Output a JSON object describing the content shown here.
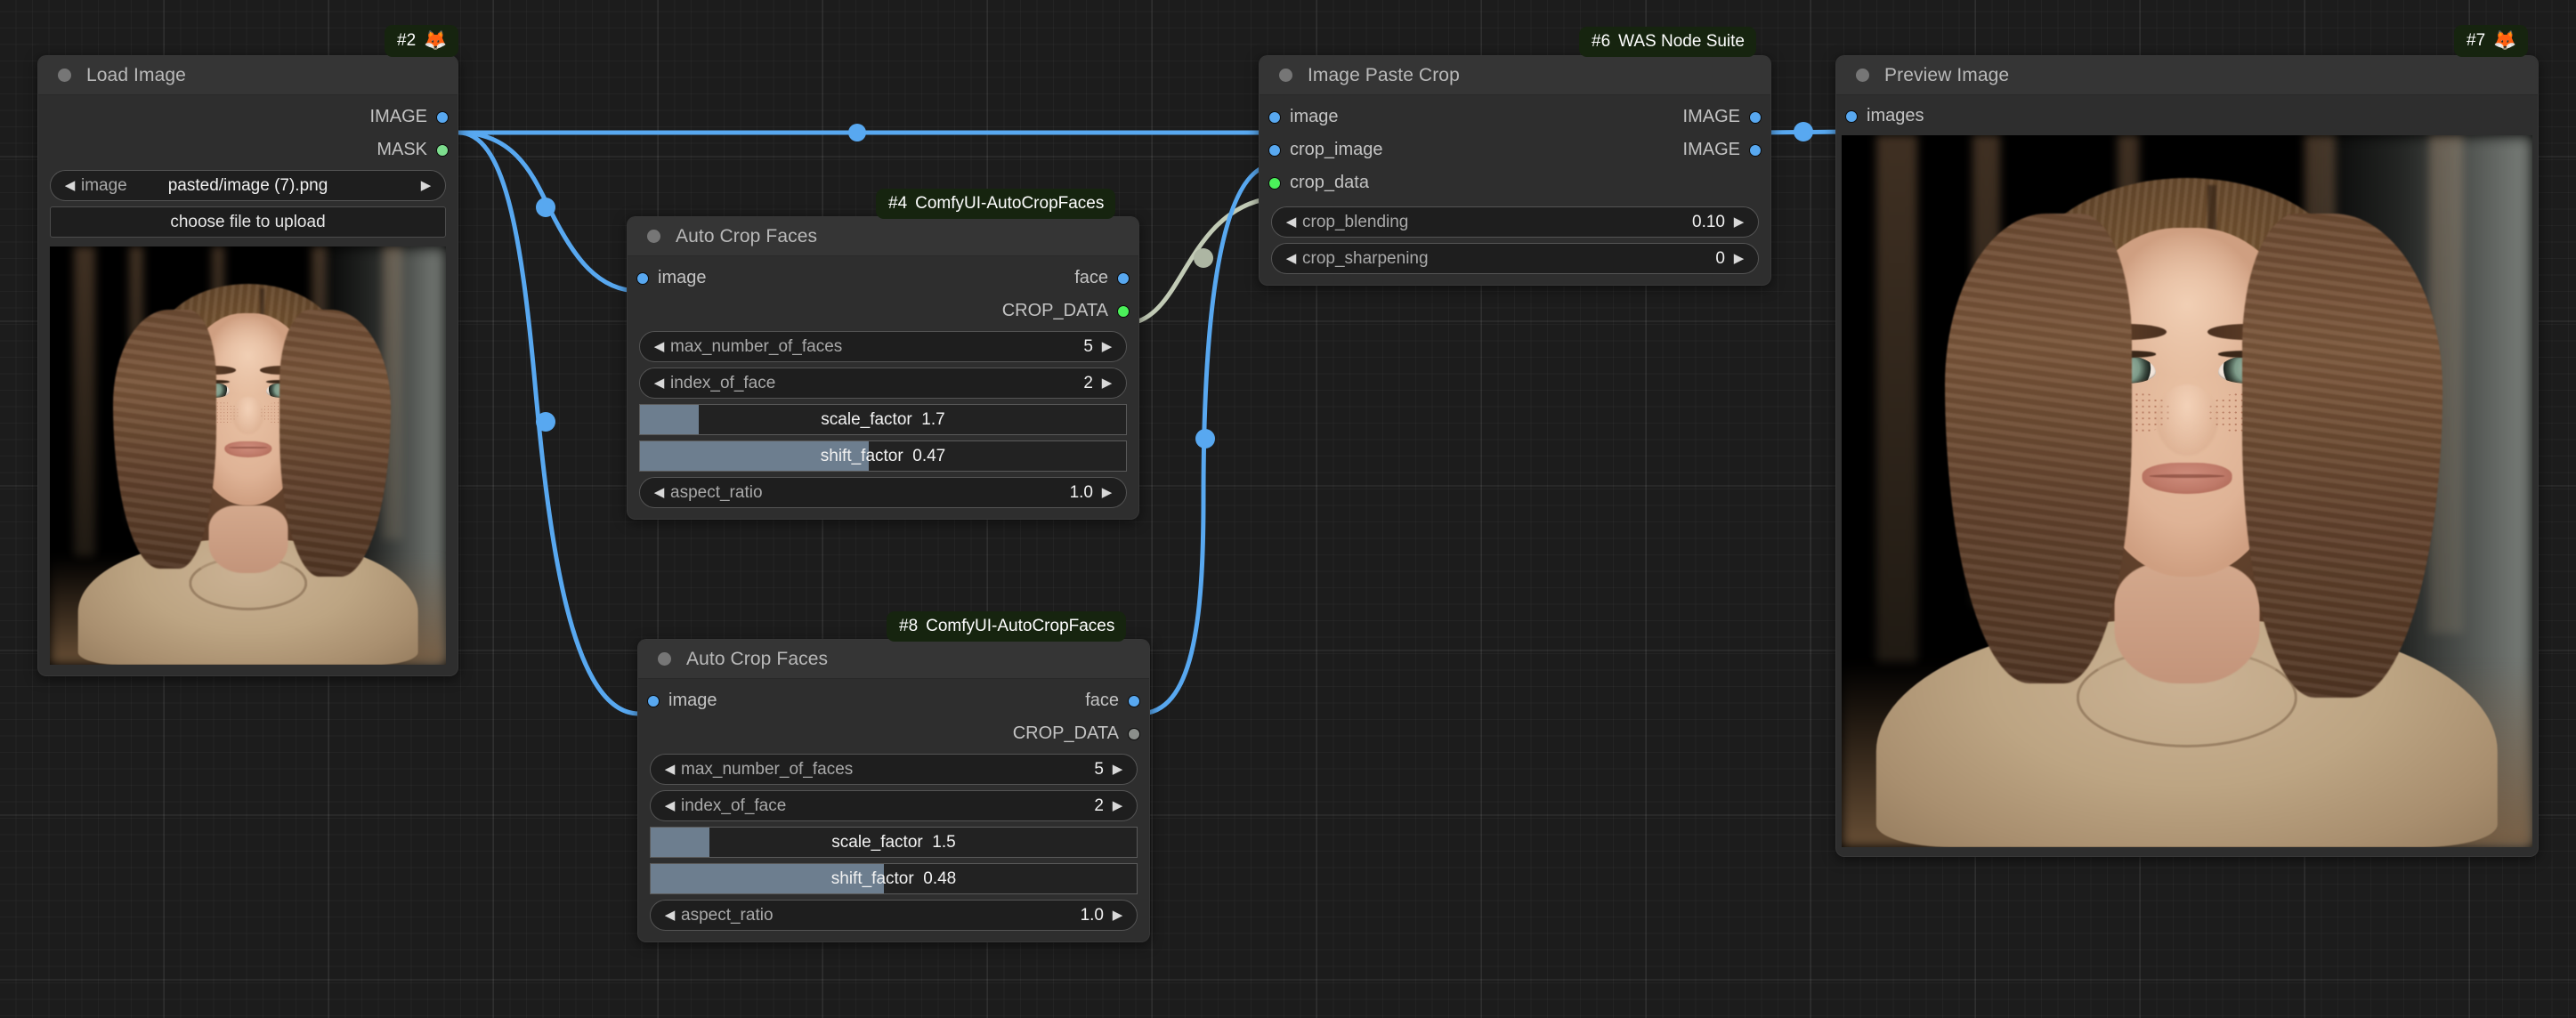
{
  "canvas": {
    "background_color": "#1c1c1c",
    "grid_color": "#2a2a2a"
  },
  "colors": {
    "node_body": "#2e2e2e",
    "node_title": "#353535",
    "badge_bg": "#16240f",
    "wire_image": "#58a8f0",
    "wire_crop_data": "#c2cbb6",
    "slot_image": "#58a8f0",
    "slot_mask": "#7ddd8e",
    "slot_crop_data": "#4bf05a",
    "slot_unconnected": "#8b8f8b",
    "slider_fill": "#6d7e8f"
  },
  "nodes": [
    {
      "id": "load-image",
      "badge": {
        "number": "#2",
        "icon": "fox-icon"
      },
      "title": "Load Image",
      "outputs": [
        {
          "name": "IMAGE",
          "type": "image"
        },
        {
          "name": "MASK",
          "type": "mask"
        }
      ],
      "widgets": [
        {
          "kind": "combo",
          "name": "image",
          "value": "pasted/image (7).png"
        },
        {
          "kind": "button",
          "label": "choose file to upload"
        }
      ]
    },
    {
      "id": "auto-crop-faces-4",
      "badge": {
        "number": "#4",
        "text": "ComfyUI-AutoCropFaces"
      },
      "title": "Auto Crop Faces",
      "inputs": [
        {
          "name": "image",
          "type": "image"
        }
      ],
      "outputs": [
        {
          "name": "face",
          "type": "image"
        },
        {
          "name": "CROP_DATA",
          "type": "crop_data"
        }
      ],
      "widgets": [
        {
          "kind": "combo",
          "name": "max_number_of_faces",
          "value": "5"
        },
        {
          "kind": "combo",
          "name": "index_of_face",
          "value": "2"
        },
        {
          "kind": "slider",
          "name": "scale_factor",
          "value": "1.7",
          "fill_percent": 12
        },
        {
          "kind": "slider",
          "name": "shift_factor",
          "value": "0.47",
          "fill_percent": 47
        },
        {
          "kind": "combo",
          "name": "aspect_ratio",
          "value": "1.0"
        }
      ]
    },
    {
      "id": "auto-crop-faces-8",
      "badge": {
        "number": "#8",
        "text": "ComfyUI-AutoCropFaces"
      },
      "title": "Auto Crop Faces",
      "inputs": [
        {
          "name": "image",
          "type": "image"
        }
      ],
      "outputs": [
        {
          "name": "face",
          "type": "image"
        },
        {
          "name": "CROP_DATA",
          "type": "unconnected"
        }
      ],
      "widgets": [
        {
          "kind": "combo",
          "name": "max_number_of_faces",
          "value": "5"
        },
        {
          "kind": "combo",
          "name": "index_of_face",
          "value": "2"
        },
        {
          "kind": "slider",
          "name": "scale_factor",
          "value": "1.5",
          "fill_percent": 12
        },
        {
          "kind": "slider",
          "name": "shift_factor",
          "value": "0.48",
          "fill_percent": 48
        },
        {
          "kind": "combo",
          "name": "aspect_ratio",
          "value": "1.0"
        }
      ]
    },
    {
      "id": "image-paste-crop",
      "badge": {
        "number": "#6",
        "text": "WAS Node Suite"
      },
      "title": "Image Paste Crop",
      "inputs": [
        {
          "name": "image",
          "type": "image"
        },
        {
          "name": "crop_image",
          "type": "image"
        },
        {
          "name": "crop_data",
          "type": "crop_data"
        }
      ],
      "outputs": [
        {
          "name": "IMAGE",
          "type": "image"
        },
        {
          "name": "IMAGE",
          "type": "image"
        }
      ],
      "widgets": [
        {
          "kind": "combo",
          "name": "crop_blending",
          "value": "0.10"
        },
        {
          "kind": "combo",
          "name": "crop_sharpening",
          "value": "0"
        }
      ]
    },
    {
      "id": "preview-image",
      "badge": {
        "number": "#7",
        "icon": "fox-icon"
      },
      "title": "Preview Image",
      "inputs": [
        {
          "name": "images",
          "type": "image"
        }
      ]
    }
  ],
  "icons": {
    "fox": "🦊",
    "arrow_left": "◀",
    "arrow_right": "▶"
  }
}
